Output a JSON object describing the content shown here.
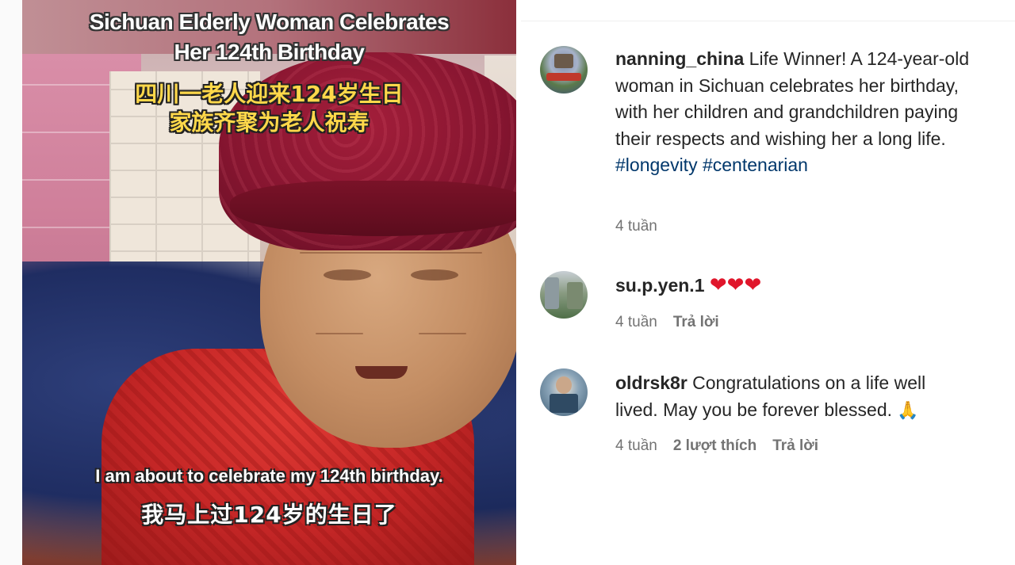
{
  "post_media": {
    "title_line1": "Sichuan Elderly Woman Celebrates",
    "title_line2": "Her 124th Birthday",
    "title_zh_line1": "四川一老人迎来124岁生日",
    "title_zh_line2": "家族齐聚为老人祝寿",
    "subtitle_en": "I am about to celebrate my 124th birthday.",
    "subtitle_zh": "我马上过124岁的生日了"
  },
  "caption": {
    "username": "nanning_china",
    "text": " Life Winner! A 124-year-old woman in Sichuan celebrates her birthday, with her children and grandchildren paying their respects and wishing her a long life. ",
    "hashtags": [
      "#longevity",
      "#centenarian"
    ],
    "time": "4 tuần",
    "avatar_icon": "city-gate-avatar"
  },
  "comments": [
    {
      "username": "su.p.yen.1",
      "text": "",
      "emoji": [
        "❤",
        "❤",
        "❤"
      ],
      "emoji_icon": "red-heart-icon",
      "time": "4 tuần",
      "likes": "",
      "reply_label": "Trả lời",
      "avatar_icon": "street-avatar"
    },
    {
      "username": "oldrsk8r",
      "text": " Congratulations on a life well lived. May you be forever blessed. ",
      "emoji": [
        "🙏"
      ],
      "emoji_icon": "folded-hands-icon",
      "time": "4 tuần",
      "likes": "2 lượt thích",
      "reply_label": "Trả lời",
      "avatar_icon": "person-avatar"
    }
  ],
  "colors": {
    "text": "#262626",
    "secondary": "#737373",
    "hashtag": "#00376b",
    "heart": "#e0162b",
    "caption_yellow": "#ffd84a"
  }
}
